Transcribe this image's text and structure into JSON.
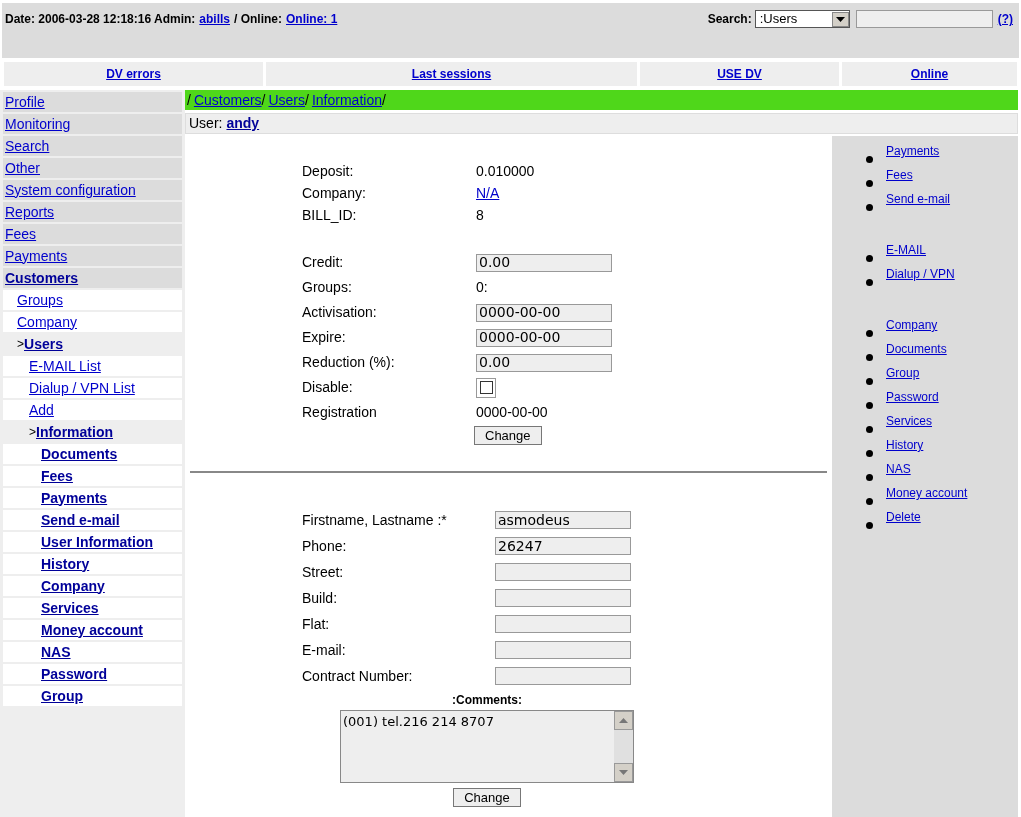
{
  "header": {
    "date_label": "Date: 2006-03-28 12:18:16 Admin:",
    "admin": "abills",
    "online_label": "/ Online:",
    "online_link": "Online: 1",
    "search": {
      "label": "Search:",
      "select_value": ":Users",
      "help": "(?)"
    }
  },
  "top_tabs": [
    {
      "label": "DV errors"
    },
    {
      "label": "Last sessions"
    },
    {
      "label": "USE DV"
    },
    {
      "label": "Online"
    }
  ],
  "sidebar": {
    "items": [
      {
        "label": "Profile",
        "selected": false
      },
      {
        "label": "Monitoring",
        "selected": false
      },
      {
        "label": "Search",
        "selected": false
      },
      {
        "label": "Other",
        "selected": false
      },
      {
        "label": "System configuration",
        "selected": false
      },
      {
        "label": "Reports",
        "selected": false
      },
      {
        "label": "Fees",
        "selected": false
      },
      {
        "label": "Payments",
        "selected": false
      },
      {
        "label": "Customers",
        "selected": true,
        "children": [
          {
            "label": "Groups",
            "selected": false
          },
          {
            "label": "Company",
            "selected": false
          },
          {
            "label": "Users",
            "selected": true,
            "prefix": ">",
            "children": [
              {
                "label": "E-MAIL List",
                "selected": false
              },
              {
                "label": "Dialup / VPN List",
                "selected": false
              },
              {
                "label": "Add",
                "selected": false
              },
              {
                "label": "Information",
                "selected": true,
                "prefix": ">",
                "children": [
                  {
                    "label": "Documents",
                    "selected": false
                  },
                  {
                    "label": "Fees",
                    "selected": false
                  },
                  {
                    "label": "Payments",
                    "selected": false
                  },
                  {
                    "label": "Send e-mail",
                    "selected": false
                  },
                  {
                    "label": "User Information",
                    "selected": false
                  },
                  {
                    "label": "History",
                    "selected": false
                  },
                  {
                    "label": "Company",
                    "selected": false
                  },
                  {
                    "label": "Services",
                    "selected": false
                  },
                  {
                    "label": "Money account",
                    "selected": false
                  },
                  {
                    "label": "NAS",
                    "selected": false
                  },
                  {
                    "label": "Password",
                    "selected": false
                  },
                  {
                    "label": "Group",
                    "selected": false
                  }
                ]
              }
            ]
          }
        ]
      }
    ]
  },
  "breadcrumb": {
    "separator": "/",
    "items": [
      "Customers",
      "Users",
      "Information"
    ]
  },
  "user_line": {
    "label": "User:",
    "user": "andy"
  },
  "account_info": [
    {
      "label": "Deposit:",
      "kind": "text",
      "value": "0.010000"
    },
    {
      "label": "Company:",
      "kind": "link",
      "value": "N/A"
    },
    {
      "label": "BILL_ID:",
      "kind": "text",
      "value": "8"
    }
  ],
  "account_settings": {
    "rows": [
      {
        "label": "Credit:",
        "kind": "input",
        "value": "0.00"
      },
      {
        "label": "Groups:",
        "kind": "text",
        "value": "0:"
      },
      {
        "label": "Activisation:",
        "kind": "input",
        "value": "0000-00-00"
      },
      {
        "label": "Expire:",
        "kind": "input",
        "value": "0000-00-00"
      },
      {
        "label": "Reduction (%):",
        "kind": "input",
        "value": "0.00"
      },
      {
        "label": "Disable:",
        "kind": "checkbox",
        "checked": false
      },
      {
        "label": "Registration",
        "kind": "text",
        "value": "0000-00-00"
      }
    ],
    "button": "Change"
  },
  "personal_info": {
    "rows": [
      {
        "label": "Firstname, Lastname :*",
        "value": "asmodeus"
      },
      {
        "label": "Phone:",
        "value": "26247"
      },
      {
        "label": "Street:"
      },
      {
        "label": "Build:"
      },
      {
        "label": "Flat:"
      },
      {
        "label": "E-mail:"
      },
      {
        "label": "Contract Number:"
      }
    ],
    "comments_label": ":Comments:",
    "comments": "(001) tel.216 214 8707",
    "button": "Change"
  },
  "right_panel": {
    "groups": [
      [
        "Payments",
        "Fees",
        "Send e-mail"
      ],
      [
        "E-MAIL",
        "Dialup / VPN"
      ],
      [
        "Company",
        "Documents",
        "Group",
        "Password",
        "Services",
        "History",
        "NAS",
        "Money account",
        "Delete"
      ]
    ]
  }
}
